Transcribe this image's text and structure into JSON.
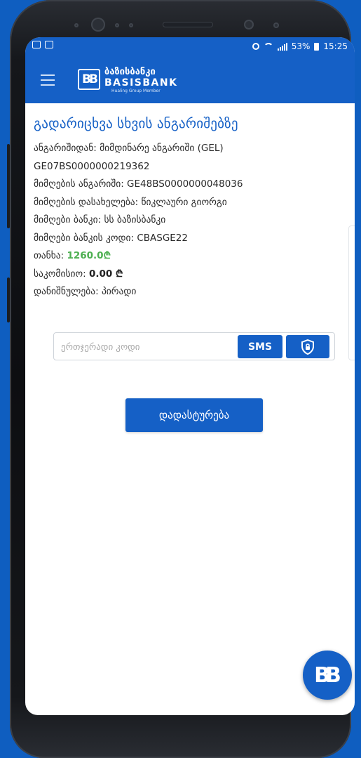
{
  "status_bar": {
    "battery": "53%",
    "time": "15:25"
  },
  "app": {
    "brand_geo": "ბაზისბანკი",
    "brand_en": "BASISBANK",
    "brand_sub": "Hualing Group Member",
    "logo_letter": "BB"
  },
  "transfer": {
    "title": "გადარიცხვა სხვის ანგარიშებზე",
    "rows": [
      {
        "label": "ანგარიშიდან:",
        "value": "მიმდინარე ანგარიში (GEL)"
      },
      {
        "label": "",
        "value": "GE07BS0000000219362"
      },
      {
        "label": "მიმღების ანგარიში:",
        "value": "GE48BS0000000048036"
      },
      {
        "label": "მიმღების დასახელება:",
        "value": "წიკლაური გიორგი"
      },
      {
        "label": "მიმღები ბანკი:",
        "value": "სს ბაზისბანკი"
      },
      {
        "label": "მიმღები ბანკის კოდი:",
        "value": "CBASGE22"
      }
    ],
    "amount_label": "თანხა:",
    "amount_value": "1260.0₾",
    "fee_label": "საკომისიო:",
    "fee_value": "0.00 ₾",
    "purpose_label": "დანიშნულება:",
    "purpose_value": "პირადი"
  },
  "otp": {
    "placeholder": "ერთჯერადი კოდი",
    "value": "",
    "sms_label": "SMS"
  },
  "confirm_label": "დადასტურება",
  "colors": {
    "brand_blue": "#1560c6",
    "amount_green": "#4caf50",
    "background_blue": "#0f5ec0"
  },
  "icons": {
    "menu": "hamburger-icon",
    "shield": "shield-lock-icon"
  }
}
